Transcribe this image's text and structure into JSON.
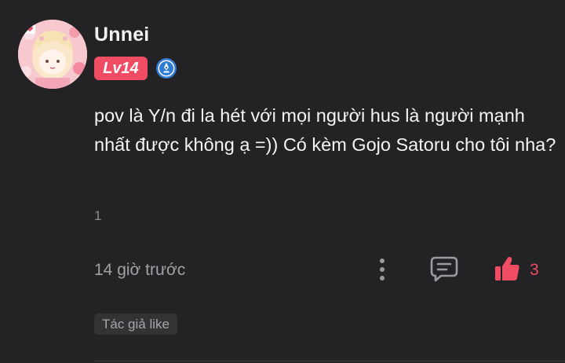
{
  "user": {
    "name": "Unnei",
    "level": "Lv14"
  },
  "comment": {
    "text": "pov là Y/n đi la hét với mọi người hus là người mạnh nhất được không ạ =)) Có kèm Gojo Satoru cho tôi nha?",
    "reply_count": "1",
    "timestamp": "14 giờ trước",
    "like_count": "3",
    "author_like_label": "Tác giả like"
  },
  "icons": {
    "verified": "verified-badge-icon",
    "more": "more-vertical-icon",
    "reply": "comment-reply-icon",
    "like": "thumbs-up-icon"
  },
  "colors": {
    "background": "#232325",
    "accent": "#f04c63",
    "verified_blue": "#2f7bd6",
    "muted_text": "#a0a0a5"
  }
}
